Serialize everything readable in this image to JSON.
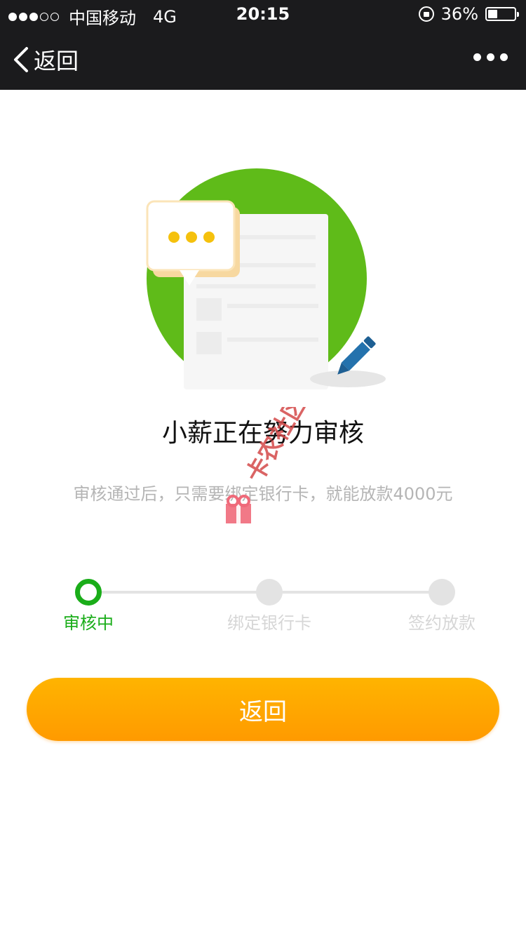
{
  "status_bar": {
    "carrier": "中国移动",
    "network": "4G",
    "time": "20:15",
    "battery_percent": "36%",
    "battery_level": 0.36
  },
  "nav": {
    "back_label": "返回",
    "more_icon": "more-dots-icon"
  },
  "main": {
    "title": "小薪正在努力审核",
    "subtitle": "审核通过后，只需要绑定银行卡，就能放款4000元"
  },
  "steps": [
    {
      "label": "审核中",
      "state": "active"
    },
    {
      "label": "绑定银行卡",
      "state": "inactive"
    },
    {
      "label": "签约放款",
      "state": "inactive"
    }
  ],
  "button": {
    "label": "返回"
  },
  "watermark": {
    "text": "卡农社区"
  },
  "colors": {
    "accent_green": "#1aad19",
    "button_orange": "#ffa800",
    "nav_bg": "#1b1b1d",
    "circle_green": "#5fbb19"
  }
}
